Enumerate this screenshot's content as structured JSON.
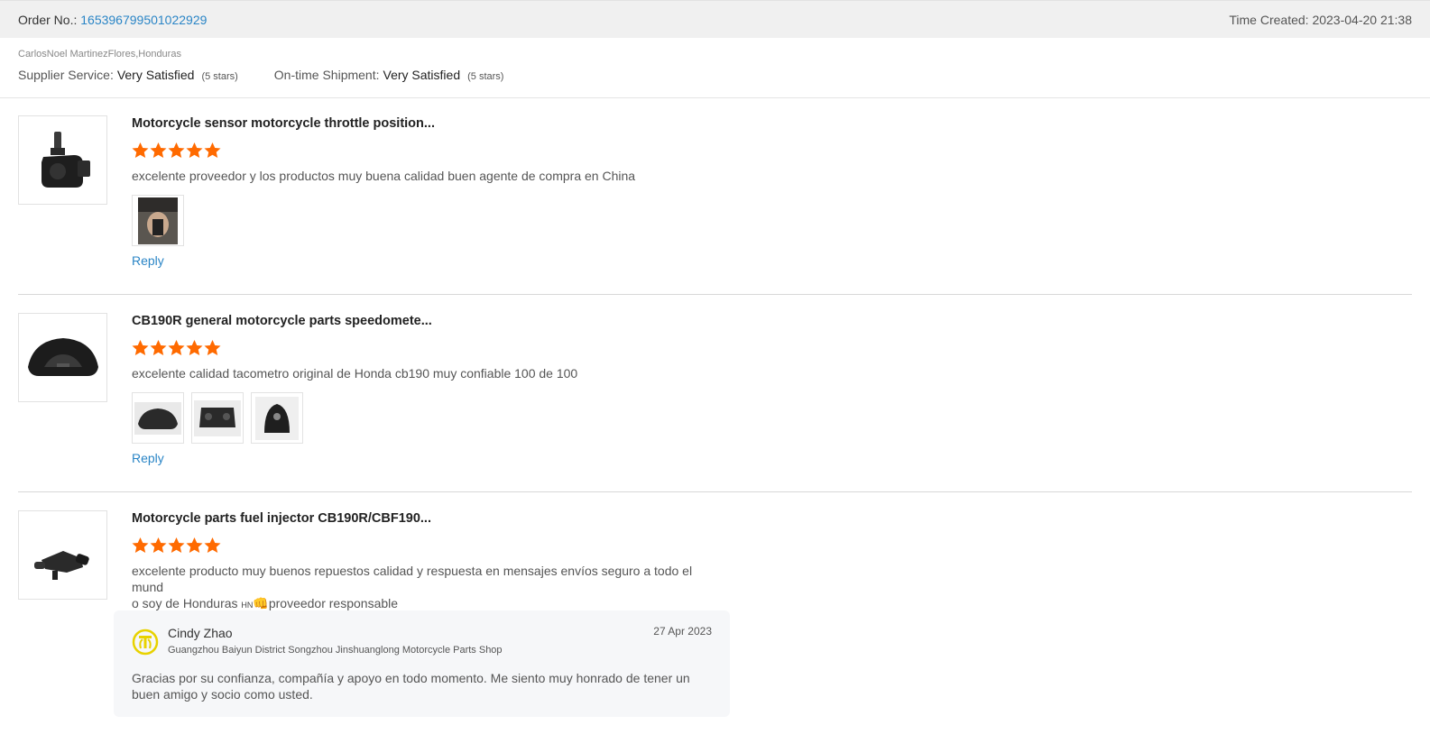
{
  "order": {
    "label": "Order No.:",
    "number": "165396799501022929",
    "time_label": "Time Created: ",
    "time": "2023-04-20 21:38"
  },
  "buyer": {
    "name": "CarlosNoel MartinezFlores,Honduras",
    "supplier_service_label": "Supplier Service:",
    "supplier_service_value": "Very Satisfied",
    "supplier_service_stars": "(5 stars)",
    "shipment_label": "On-time Shipment:",
    "shipment_value": "Very Satisfied",
    "shipment_stars": "(5 stars)"
  },
  "colors": {
    "star": "#ff6a00",
    "link": "#2a85c6",
    "header_bg": "#f0f0f0",
    "reply_bg": "#f6f7f9",
    "avatar": "#e8d200"
  },
  "items": [
    {
      "title": "Motorcycle sensor motorcycle throttle position...",
      "rating": 5,
      "review": "excelente proveedor y los productos muy buena calidad buen agente de compra en China",
      "photos": 1,
      "reply_label": "Reply"
    },
    {
      "title": "CB190R general motorcycle parts speedomete...",
      "rating": 5,
      "review": "excelente calidad tacometro original de Honda cb190 muy confiable 100 de 100",
      "photos": 3,
      "reply_label": "Reply"
    },
    {
      "title": "Motorcycle parts fuel injector CB190R/CBF190...",
      "rating": 5,
      "review_line1": "excelente producto muy buenos repuestos calidad y respuesta en mensajes envíos seguro a todo el mund",
      "review_line2_prefix": "o soy de Honduras ",
      "review_flag": "HN",
      "review_emoji": "👊",
      "review_line2_suffix": "proveedor responsable",
      "seller_reply": {
        "name": "Cindy Zhao",
        "shop": "Guangzhou Baiyun District Songzhou Jinshuanglong Motorcycle Parts Shop",
        "date": "27 Apr 2023",
        "text": "Gracias por su confianza, compañía y apoyo en todo momento. Me siento muy honrado de tener un buen amigo y socio como usted."
      }
    }
  ]
}
